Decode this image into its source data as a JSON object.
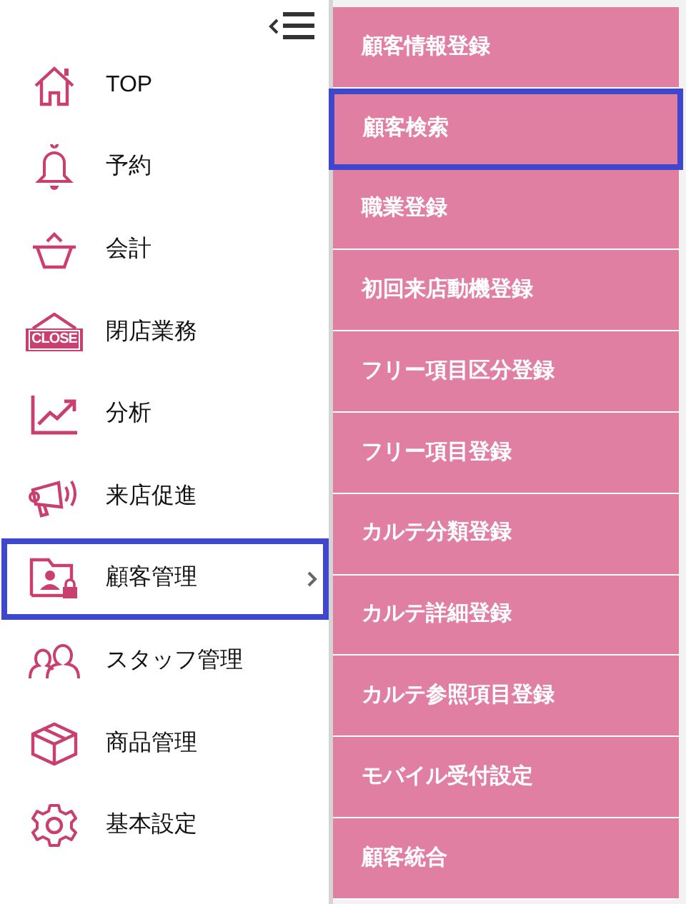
{
  "menu": {
    "items": [
      {
        "label": "TOP",
        "selected": false,
        "expanded": false
      },
      {
        "label": "予約",
        "selected": false,
        "expanded": false
      },
      {
        "label": "会計",
        "selected": false,
        "expanded": false
      },
      {
        "label": "閉店業務",
        "selected": false,
        "expanded": false,
        "sign_text": "CLOSE"
      },
      {
        "label": "分析",
        "selected": false,
        "expanded": false
      },
      {
        "label": "来店促進",
        "selected": false,
        "expanded": false
      },
      {
        "label": "顧客管理",
        "selected": true,
        "expanded": true
      },
      {
        "label": "スタッフ管理",
        "selected": false,
        "expanded": false
      },
      {
        "label": "商品管理",
        "selected": false,
        "expanded": false
      },
      {
        "label": "基本設定",
        "selected": false,
        "expanded": false
      }
    ]
  },
  "submenu": {
    "items": [
      {
        "label": "顧客情報登録",
        "selected": false
      },
      {
        "label": "顧客検索",
        "selected": true
      },
      {
        "label": "職業登録",
        "selected": false
      },
      {
        "label": "初回来店動機登録",
        "selected": false
      },
      {
        "label": "フリー項目区分登録",
        "selected": false
      },
      {
        "label": "フリー項目登録",
        "selected": false
      },
      {
        "label": "カルテ分類登録",
        "selected": false
      },
      {
        "label": "カルテ詳細登録",
        "selected": false
      },
      {
        "label": "カルテ参照項目登録",
        "selected": false
      },
      {
        "label": "モバイル受付設定",
        "selected": false
      },
      {
        "label": "顧客統合",
        "selected": false
      }
    ]
  }
}
